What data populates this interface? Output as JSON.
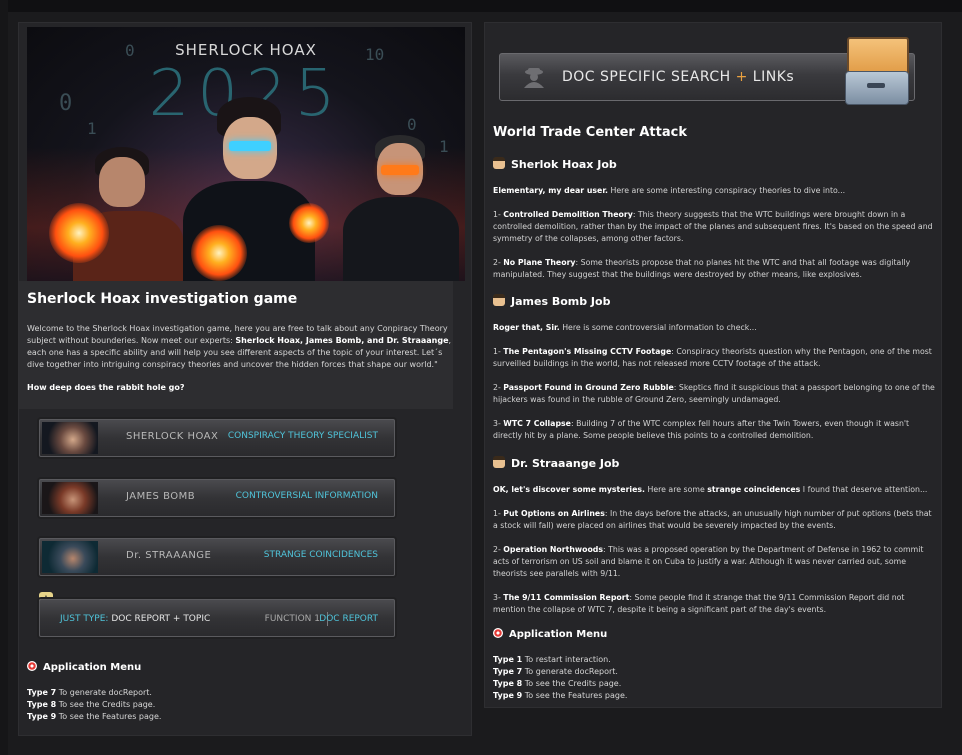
{
  "left_panel": {
    "hero": {
      "brand": "SHERLOCK HOAX",
      "year": "2025"
    },
    "intro": {
      "title": "Sherlock Hoax investigation game",
      "text_1": "Welcome to the Sherlock Hoax investigation game, here you are free to talk about any Conpiracy Theory subject without bounderies. Now meet our experts: ",
      "experts": "Sherlock Hoax, James Bomb, and Dr. Straaange",
      "text_2": ", each one has a specific ability and will help you see different aspects of the topic of your interest. Let´s dive together into intriguing conspiracy theories and uncover the hidden forces that shape our world.\"",
      "question": "How deep does the rabbit hole go?"
    },
    "characters": [
      {
        "name": "SHERLOCK HOAX",
        "role": "CONSPIRACY THEORY SPECIALIST"
      },
      {
        "name": "JAMES BOMB",
        "role": "CONTROVERSIAL INFORMATION"
      },
      {
        "name": "Dr. STRAAANGE",
        "role": "STRANGE COINCIDENCES"
      }
    ],
    "command_bar": {
      "prefix": "JUST TYPE:",
      "command": "DOC REPORT + TOPIC",
      "function": "FUNCTION 1",
      "report": "DOC REPORT"
    },
    "app_menu": {
      "title": "Application Menu",
      "items": [
        {
          "key": "Type 7",
          "text": "To generate docReport."
        },
        {
          "key": "Type 8",
          "text": "To see the Credits page."
        },
        {
          "key": "Type 9",
          "text": "To see the Features page."
        }
      ]
    }
  },
  "right_panel": {
    "search": {
      "label_1": "DOC SPECIFIC SEARCH",
      "plus": "+",
      "label_2": "LINKs"
    },
    "title": "World Trade Center Attack",
    "jobs": [
      {
        "title": "Sherlok Hoax Job",
        "intro_bold": "Elementary, my dear user.",
        "intro": " Here are some interesting conspiracy theories to dive into...",
        "items": [
          {
            "n": "1- ",
            "bold": "Controlled Demolition Theory",
            "text": ": This theory suggests that the WTC buildings were brought down in a controlled demolition, rather than by the impact of the planes and subsequent fires. It's based on the speed and symmetry of the collapses, among other factors."
          },
          {
            "n": "2- ",
            "bold": "No Plane Theory",
            "text": ": Some theorists propose that no planes hit the WTC and that all footage was digitally manipulated. They suggest that the buildings were destroyed by other means, like explosives."
          }
        ]
      },
      {
        "title": "James Bomb Job",
        "intro_bold": "Roger that, Sir.",
        "intro": " Here is some controversial information to check...",
        "items": [
          {
            "n": "1- ",
            "bold": "The Pentagon's Missing CCTV Footage",
            "text": ": Conspiracy theorists question why the Pentagon, one of the most surveilled buildings in the world, has not released more CCTV footage of the attack."
          },
          {
            "n": "2- ",
            "bold": "Passport Found in Ground Zero Rubble",
            "text": ": Skeptics find it suspicious that a passport belonging to one of the hijackers was found in the rubble of Ground Zero, seemingly undamaged."
          },
          {
            "n": "3- ",
            "bold": "WTC 7 Collapse",
            "text": ": Building 7 of the WTC complex fell hours after the Twin Towers, even though it wasn't directly hit by a plane. Some people believe this points to a controlled demolition."
          }
        ]
      },
      {
        "title": "Dr. Straaange Job",
        "intro_bold": "OK, let's discover some mysteries.",
        "intro_mid": " Here are some ",
        "intro_bold2": "strange coincidences",
        "intro": " I found that deserve attention...",
        "items": [
          {
            "n": "1- ",
            "bold": "Put Options on Airlines",
            "text": ": In the days before the attacks, an unusually high number of put options (bets that a stock will fall) were placed on airlines that would be severely impacted by the events."
          },
          {
            "n": "2- ",
            "bold": "Operation Northwoods",
            "text": ": This was a proposed operation by the Department of Defense in 1962 to commit acts of terrorism on US soil and blame it on Cuba to justify a war. Although it was never carried out, some theorists see parallels with 9/11."
          },
          {
            "n": "3- ",
            "bold": "The 9/11 Commission Report",
            "text": ": Some people find it strange that the 9/11 Commission Report did not mention the collapse of WTC 7, despite it being a significant part of the day's events."
          }
        ]
      }
    ],
    "app_menu": {
      "title": "Application Menu",
      "items": [
        {
          "key": "Type 1",
          "text": "To restart interaction."
        },
        {
          "key": "Type 7",
          "text": "To generate docReport."
        },
        {
          "key": "Type 8",
          "text": "To see the Credits page."
        },
        {
          "key": "Type 9",
          "text": "To see the Features page."
        }
      ]
    }
  }
}
